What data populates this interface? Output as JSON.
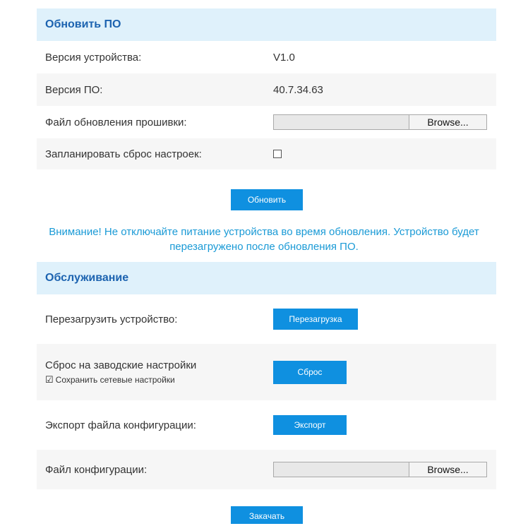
{
  "upgrade": {
    "title": "Обновить ПО",
    "device_version_label": "Версия устройства:",
    "device_version_value": "V1.0",
    "firmware_version_label": "Версия ПО:",
    "firmware_version_value": "40.7.34.63",
    "firmware_file_label": "Файл обновления прошивки:",
    "browse_label": "Browse...",
    "schedule_reset_label": "Запланировать сброс настроек:",
    "schedule_reset_checked": false,
    "update_button": "Обновить"
  },
  "warning": {
    "line1": "Внимание! Не отключайте питание устройства во время обновления. Устройство будет",
    "line2": "перезагружено после обновления ПО."
  },
  "maintenance": {
    "title": "Обслуживание",
    "reboot_label": "Перезагрузить устройство:",
    "reboot_button": "Перезагрузка",
    "factory_reset_label": "Сброс на заводские настройки",
    "keep_network_label": "Сохранить сетевые настройки",
    "keep_network_checked": true,
    "reset_button": "Сброс",
    "export_label": "Экспорт файла конфигурации:",
    "export_button": "Экспорт",
    "config_file_label": "Файл конфигурации:",
    "browse_label": "Browse...",
    "upload_button": "Закачать"
  },
  "colors": {
    "header_bg": "#dff1fb",
    "header_text": "#1c63b0",
    "button_bg": "#0f90e0",
    "warning_text": "#1a9ad6"
  }
}
